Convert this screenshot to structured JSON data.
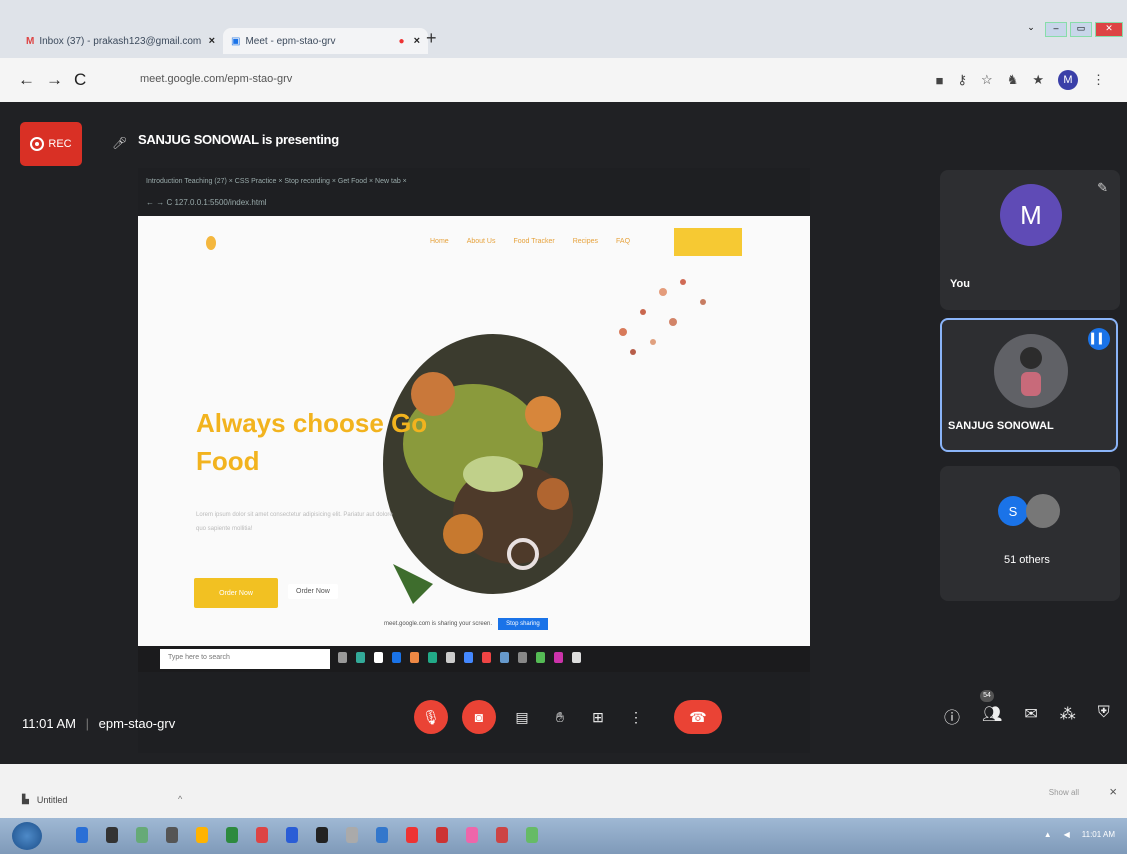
{
  "browser": {
    "tabs": [
      {
        "title": "Inbox (37) - prakash123@gmail.com"
      },
      {
        "title": "Meet - epm-stao-grv"
      }
    ],
    "tab_close": "×",
    "new_tab": "+",
    "url": "meet.google.com/epm-stao-grv",
    "profile_initial": "M"
  },
  "meet": {
    "rec_label": "REC",
    "presenting_text": "SANJUG SONOWAL is presenting",
    "shared_screen": {
      "tabs_text": "Introduction Teaching (27) ×   CSS Practice   ×   Stop recording   ×   Get Food   ×   New tab   ×",
      "address_text": "127.0.0.1:5500/index.html",
      "site": {
        "nav": [
          "Home",
          "About Us",
          "Food Tracker",
          "Recipes",
          "FAQ"
        ],
        "signup": "",
        "hero_title_line1": "Always choose Go",
        "hero_title_line2": "Food",
        "lorem": "Lorem ipsum dolor sit amet consectetur adipisicing elit. Pariatur aut dolore quo sapiente mollitia!",
        "order_button": "Order Now",
        "order_outline": "Order Now",
        "share_notice": "meet.google.com is sharing your screen.",
        "stop_sharing": "Stop sharing"
      },
      "search_placeholder": "Type here to search"
    },
    "participants": [
      {
        "name": "You",
        "initial": "M",
        "color": "#5f4bb6"
      },
      {
        "name": "SANJUG SONOWAL",
        "speaking": true
      },
      {
        "name": "51 others",
        "initial": "S",
        "color": "#1a73e8"
      }
    ],
    "time": "11:01 AM",
    "divider": "|",
    "meeting_code": "epm-stao-grv",
    "participant_badge": "54"
  },
  "downloads": {
    "file": "Untitled",
    "show_all": "Show all",
    "close": "×"
  },
  "taskbar": {
    "clock": "11:01 AM"
  }
}
